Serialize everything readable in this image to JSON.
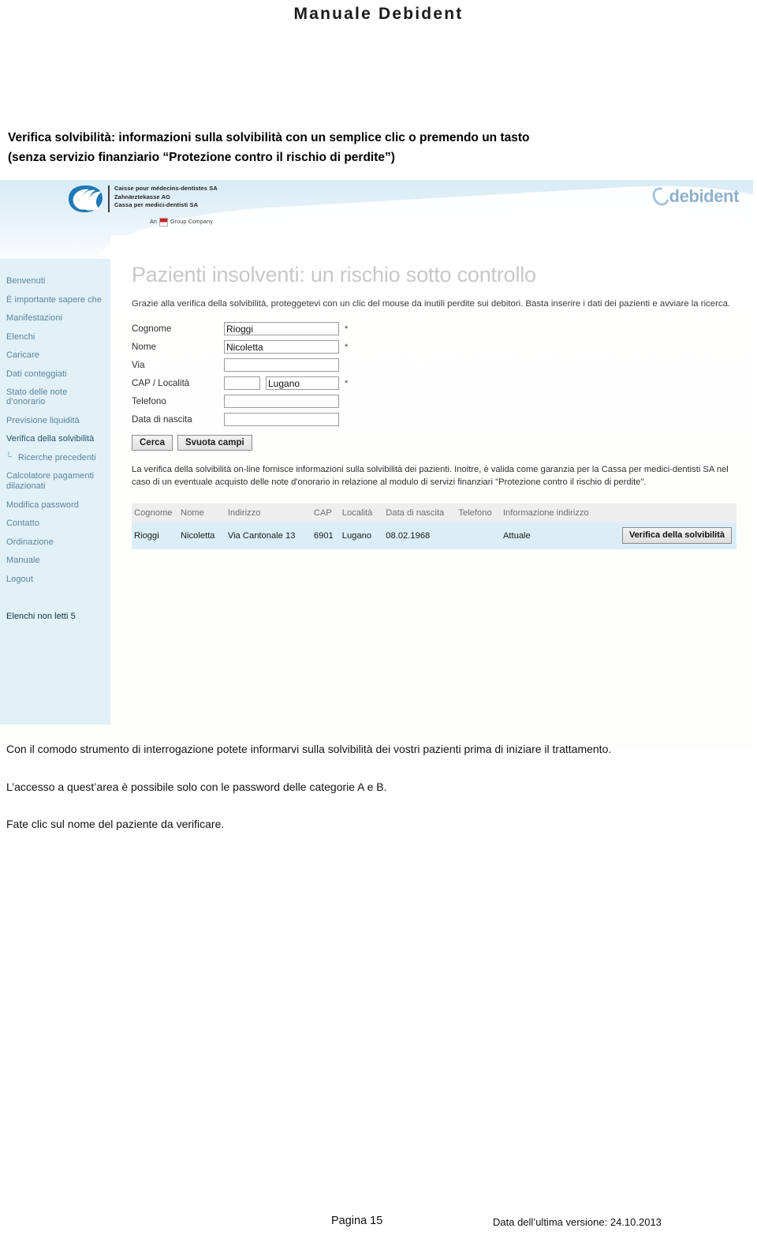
{
  "document": {
    "title": "Manuale Debident",
    "section_heading_line1": "Verifica solvibilità: informazioni sulla solvibilità con un semplice clic o premendo un tasto",
    "section_heading_line2": "(senza servizio finanziario “Protezione contro il rischio di perdite”)",
    "body_paragraphs": [
      "Con il comodo strumento di interrogazione potete informarvi sulla solvibilità dei vostri pazienti prima di iniziare il trattamento.",
      "L’accesso a quest’area è possibile solo con le password delle categorie A e B.",
      "Fate clic sul nome del paziente da verificare."
    ],
    "footer": {
      "page_label": "Pagina 15",
      "version_label": "Data dell’ultima versione: 24.10.2013"
    }
  },
  "screenshot": {
    "header": {
      "brand_lines": [
        "Caisse pour médecins-dentistes SA",
        "Zahnärztekasse AG",
        "Cassa per medici-dentisti SA"
      ],
      "group_company_prefix": "An",
      "group_company_suffix": "Group Company",
      "logo_text": "debident",
      "logo_icon": "swoosh-wave-icon",
      "accent_color": "#5b8db5",
      "band_color": "#e2f0f7"
    },
    "sidebar": {
      "items": [
        {
          "label": "Benvenuti",
          "active": false,
          "sub": false
        },
        {
          "label": "È importante sapere che",
          "active": false,
          "sub": false
        },
        {
          "label": "Manifestazioni",
          "active": false,
          "sub": false
        },
        {
          "label": "Elenchi",
          "active": false,
          "sub": false
        },
        {
          "label": "Caricare",
          "active": false,
          "sub": false
        },
        {
          "label": "Dati conteggiati",
          "active": false,
          "sub": false
        },
        {
          "label": "Stato delle note d’onorario",
          "active": false,
          "sub": false
        },
        {
          "label": "Previsione liquidità",
          "active": false,
          "sub": false
        },
        {
          "label": "Verifica della solvibilità",
          "active": true,
          "sub": false
        },
        {
          "label": "Ricerche precedenti",
          "active": false,
          "sub": true,
          "tree_glyph": "└"
        },
        {
          "label": "Calcolatore pagamenti dilazionati",
          "active": false,
          "sub": false
        },
        {
          "label": "Modifica password",
          "active": false,
          "sub": false
        },
        {
          "label": "Contatto",
          "active": false,
          "sub": false
        },
        {
          "label": "Ordinazione",
          "active": false,
          "sub": false
        },
        {
          "label": "Manuale",
          "active": false,
          "sub": false
        },
        {
          "label": "Logout",
          "active": false,
          "sub": false
        }
      ],
      "unread_label": "Elenchi non letti 5"
    },
    "main": {
      "page_title": "Pazienti insolventi: un rischio sotto controllo",
      "intro_text": "Grazie alla verifica della solvibilità, proteggetevi con un clic del mouse da inutili perdite sui debitori. Basta inserire i dati dei pazienti e avviare la ricerca.",
      "form": {
        "fields": [
          {
            "label": "Cognome",
            "value": "Rioggi",
            "required": "*",
            "placeholder": ""
          },
          {
            "label": "Nome",
            "value": "Nicoletta",
            "required": "*",
            "placeholder": ""
          },
          {
            "label": "Via",
            "value": "",
            "required": "",
            "placeholder": ""
          },
          {
            "label": "CAP / Località",
            "value_cap": "",
            "value_loc": "Lugano",
            "required": "*",
            "placeholder": ""
          },
          {
            "label": "Telefono",
            "value": "",
            "required": "",
            "placeholder": ""
          },
          {
            "label": "Data di nascita",
            "value": "",
            "required": "",
            "placeholder": ""
          }
        ],
        "search_button": "Cerca",
        "clear_button": "Svuota campi"
      },
      "legal_text": "La verifica della solvibilità on-line fornisce informazioni sulla solvibilità dei pazienti. Inoltre, è valida come garanzia per la Cassa per medici-dentisti SA nel caso di un eventuale acquisto delle note d'onorario in relazione al modulo di servizi finanziari \"Protezione contro il rischio di perdite\".",
      "results": {
        "columns": [
          "Cognome",
          "Nome",
          "Indirizzo",
          "CAP",
          "Località",
          "Data di nascita",
          "Telefono",
          "Informazione indirizzo",
          ""
        ],
        "rows": [
          {
            "cognome": "Rioggi",
            "nome": "Nicoletta",
            "indirizzo": "Via Cantonale 13",
            "cap": "6901",
            "localita": "Lugano",
            "data_di_nascita": "08.02.1968",
            "telefono": "",
            "informazione_indirizzo": "Attuale",
            "action_button": "Verifica della solvibilità"
          }
        ]
      }
    }
  }
}
